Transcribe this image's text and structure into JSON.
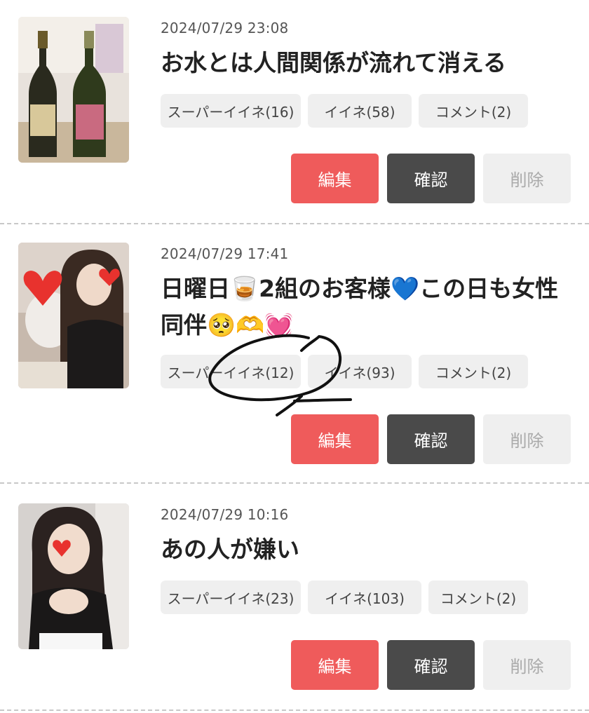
{
  "posts": [
    {
      "date": "2024/07/29 23:08",
      "title": "お水とは人間関係が流れて消える",
      "super_like": "スーパーイイネ(16)",
      "like": "イイネ(58)",
      "comment": "コメント(2)"
    },
    {
      "date": "2024/07/29 17:41",
      "title": "日曜日🥃2組のお客様💙この日も女性同伴🥺🫶💓",
      "super_like": "スーパーイイネ(12)",
      "like": "イイネ(93)",
      "comment": "コメント(2)"
    },
    {
      "date": "2024/07/29 10:16",
      "title": "あの人が嫌い",
      "super_like": "スーパーイイネ(23)",
      "like": "イイネ(103)",
      "comment": "コメント(2)"
    }
  ],
  "actions": {
    "edit": "編集",
    "confirm": "確認",
    "delete": "削除"
  },
  "colors": {
    "edit": "#ef5b5b",
    "confirm": "#4a4a4a",
    "delete": "#efefef",
    "chip": "#efefef"
  }
}
